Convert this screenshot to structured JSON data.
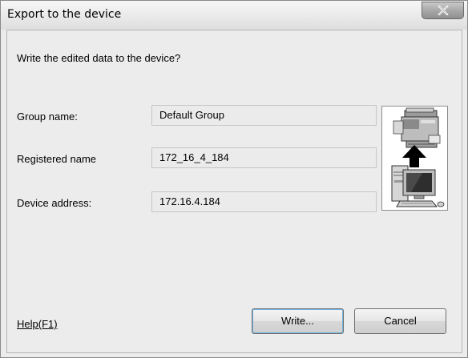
{
  "window": {
    "title": "Export to the device"
  },
  "dialog": {
    "prompt": "Write the edited data to the device?",
    "group_name_label": "Group name:",
    "group_name_value": "Default Group",
    "registered_name_label": "Registered name",
    "registered_name_value": "172_16_4_184",
    "device_address_label": "Device address:",
    "device_address_value": "172.16.4.184",
    "image_icon": "printer-export-from-pc-icon"
  },
  "footer": {
    "help_label": "Help(F1)",
    "write_label": "Write...",
    "cancel_label": "Cancel"
  }
}
